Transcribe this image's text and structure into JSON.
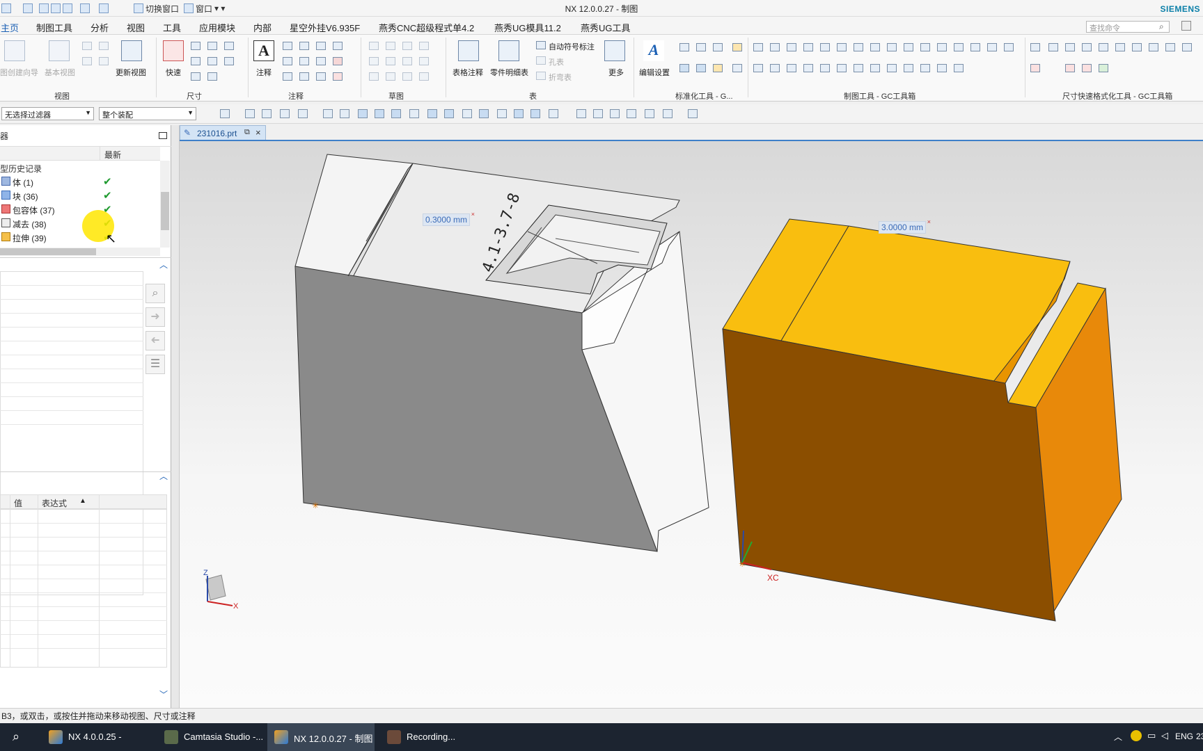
{
  "window": {
    "title": "NX 12.0.0.27 - 制图",
    "brand": "SIEMENS",
    "quick_access": {
      "switch_window": "切换窗口",
      "window": "窗口"
    }
  },
  "menu": {
    "tabs": [
      "主页",
      "制图工具",
      "分析",
      "视图",
      "工具",
      "应用模块",
      "内部",
      "星空外挂V6.935F",
      "燕秀CNC超级程式单4.2",
      "燕秀UG模具11.2",
      "燕秀UG工具"
    ],
    "search_placeholder": "查找命令"
  },
  "ribbon": {
    "groups": {
      "view": "视图",
      "dimension": "尺寸",
      "annotation": "注释",
      "sketch": "草图",
      "table": "表",
      "std": "标准化工具 - G...",
      "drafting": "制图工具 - GC工具箱",
      "dimfmt": "尺寸快速格式化工具 - GC工具箱"
    },
    "labels": {
      "view_wizard": "图创建向导",
      "base_view": "基本视图",
      "update_view": "更新视图",
      "quick": "快速",
      "note": "注释",
      "table_note": "表格注释",
      "parts_list": "零件明细表",
      "auto_symbol": "自动符号标注",
      "hole_table": "孔表",
      "bend_table": "折弯表",
      "more": "更多",
      "edit_settings": "编辑设置"
    }
  },
  "selection_bar": {
    "filter": "无选择过滤器",
    "scope": "整个装配"
  },
  "navigator": {
    "header_fragment": "器",
    "col_latest": "最新",
    "history_label": "型历史记录",
    "items": [
      {
        "label": "体 (1)",
        "status": "✔"
      },
      {
        "label": "块 (36)",
        "status": "✔"
      },
      {
        "label": "包容体 (37)",
        "status": "✔"
      },
      {
        "label": "减去 (38)",
        "status": "✔"
      },
      {
        "label": "拉伸 (39)",
        "status": "✔"
      }
    ],
    "expr_cols": {
      "value": "值",
      "expression": "表达式"
    }
  },
  "document": {
    "tab_label": "231016.prt",
    "dim_labels": [
      "0.3000 mm",
      "3.0000 mm"
    ],
    "engraving": "4.1-3.7-8",
    "axis_labels": {
      "xc": "XC",
      "z": "Z",
      "x": "X"
    }
  },
  "status": {
    "message": "B3，或双击，或按住并拖动来移动视图、尺寸或注释"
  },
  "taskbar": {
    "items": [
      {
        "label": "NX 4.0.0.25 -"
      },
      {
        "label": "Camtasia Studio -..."
      },
      {
        "label": "NX 12.0.0.27 - 制图"
      },
      {
        "label": "Recording..."
      }
    ],
    "lang": "ENG",
    "time_fragment": "23"
  },
  "colors": {
    "accent": "#1a5fb4",
    "part_orange": "#f9be0f",
    "part_gray": "#8a8a8a",
    "check_green": "#1e9a2e"
  }
}
